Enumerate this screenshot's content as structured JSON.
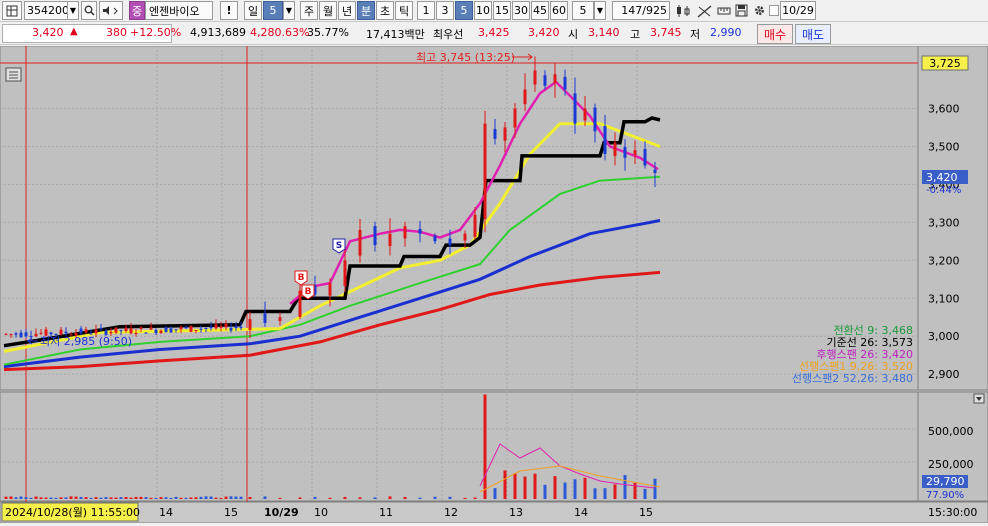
{
  "toolbar": {
    "code": "354200",
    "grade_badge": "중",
    "stock_name": "엔젠바이오",
    "alert": "!",
    "period_day": "일",
    "period_min_value": "5",
    "period_week": "주",
    "period_month": "월",
    "period_year": "년",
    "period_minute": "분",
    "period_second": "초",
    "period_tick": "틱",
    "intervals": [
      "1",
      "3",
      "5",
      "10",
      "15",
      "30",
      "45",
      "60"
    ],
    "interval_selected": "5",
    "count_value": "5",
    "bar_count": "147/925",
    "date_value": "10/29"
  },
  "info": {
    "price": "3,420",
    "price_arrow": "▲",
    "change": "380",
    "change_pct": "+12.50%",
    "volume": "4,913,689",
    "volume_ratio": "4,280.63%",
    "turnover": "35.77%",
    "amount": "17,413백만",
    "best_bid_label": "최우선",
    "best_bid": "3,425",
    "best_ask": "3,420",
    "open_label": "시",
    "open": "3,140",
    "high_label": "고",
    "high": "3,745",
    "low_label": "저",
    "low": "2,990",
    "buy_button": "매수",
    "sell_button": "매도"
  },
  "price_axis": {
    "ticks": [
      "3,600",
      "3,500",
      "3,400",
      "3,300",
      "3,200",
      "3,100",
      "3,000",
      "2,900"
    ],
    "current_tag": "3,420",
    "current_pct": "-0.44%",
    "high_tag": "3,725"
  },
  "annotations": {
    "high_note": "최고 3,745 (13:25)",
    "low_note": "최저 2,985 (9:50)"
  },
  "ichimoku_legend": [
    {
      "label": "전환선 9: 3,468",
      "color": "#1b9a3a"
    },
    {
      "label": "기준선 26: 3,573",
      "color": "#000000"
    },
    {
      "label": "후행스팬 26: 3,420",
      "color": "#c020c0"
    },
    {
      "label": "선행스팬1 9,26: 3,520",
      "color": "#f0a020"
    },
    {
      "label": "선행스팬2 52,26: 3,480",
      "color": "#3a6ed8"
    }
  ],
  "volume_axis": {
    "ticks": [
      "500,000",
      "250,000"
    ],
    "current_tag": "29,790",
    "current_pct": "77.90%"
  },
  "time_axis": {
    "cursor_label": "2024/10/28(월) 11:55:00",
    "labels": [
      "14",
      "15",
      "10/29",
      "10",
      "11",
      "12",
      "13",
      "14",
      "15"
    ],
    "right_label": "15:30:00"
  },
  "signals": [
    "B",
    "B",
    "S"
  ]
}
